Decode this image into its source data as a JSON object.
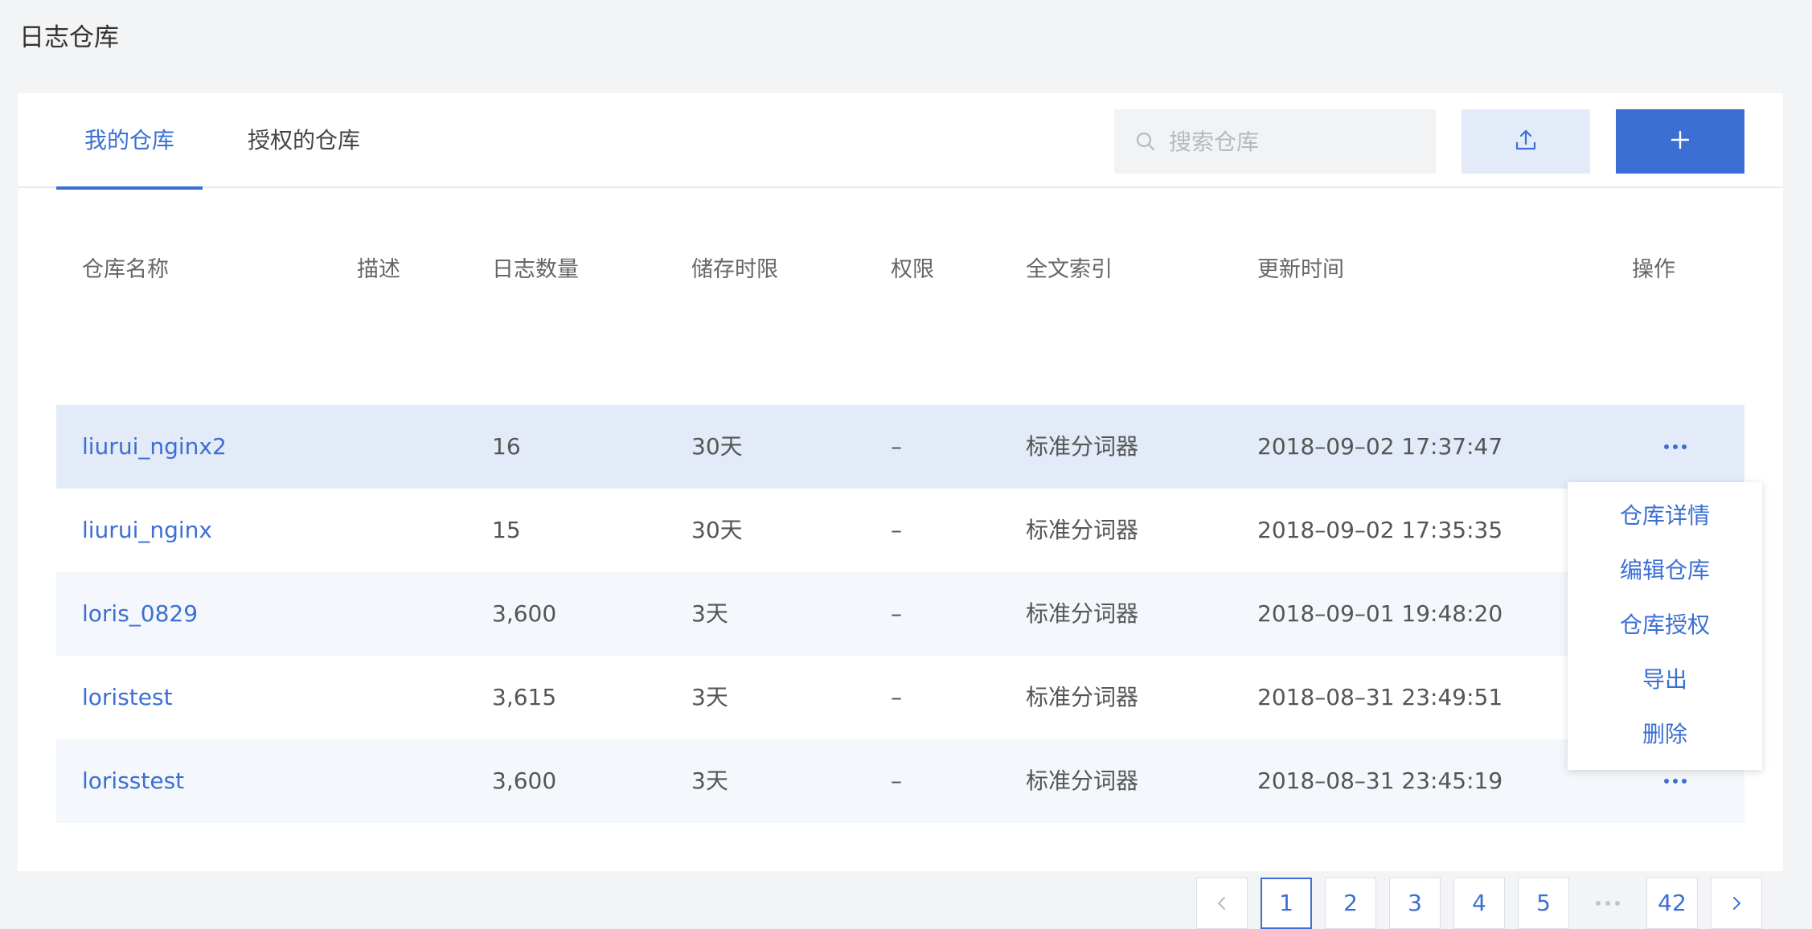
{
  "page": {
    "title": "日志仓库"
  },
  "tabs": [
    {
      "label": "我的仓库",
      "active": true
    },
    {
      "label": "授权的仓库",
      "active": false
    }
  ],
  "toolbar": {
    "search_placeholder": "搜索仓库",
    "upload_icon": "upload-icon",
    "add_icon": "plus-icon"
  },
  "table": {
    "headers": {
      "name": "仓库名称",
      "desc": "描述",
      "count": "日志数量",
      "retention": "储存时限",
      "perm": "权限",
      "index": "全文索引",
      "time": "更新时间",
      "ops": "操作"
    },
    "rows": [
      {
        "name": "liurui_nginx2",
        "desc": "",
        "count": "16",
        "retention": "30天",
        "perm": "–",
        "index": "标准分词器",
        "time": "2018–09–02 17:37:47"
      },
      {
        "name": "liurui_nginx",
        "desc": "",
        "count": "15",
        "retention": "30天",
        "perm": "–",
        "index": "标准分词器",
        "time": "2018–09–02 17:35:35"
      },
      {
        "name": "loris_0829",
        "desc": "",
        "count": "3,600",
        "retention": "3天",
        "perm": "–",
        "index": "标准分词器",
        "time": "2018–09–01 19:48:20"
      },
      {
        "name": "loristest",
        "desc": "",
        "count": "3,615",
        "retention": "3天",
        "perm": "–",
        "index": "标准分词器",
        "time": "2018–08–31 23:49:51"
      },
      {
        "name": "lorisstest",
        "desc": "",
        "count": "3,600",
        "retention": "3天",
        "perm": "–",
        "index": "标准分词器",
        "time": "2018–08–31 23:45:19"
      }
    ]
  },
  "dropdown": {
    "items": [
      "仓库详情",
      "编辑仓库",
      "仓库授权",
      "导出",
      "删除"
    ]
  },
  "pagination": {
    "prev": "<",
    "pages": [
      "1",
      "2",
      "3",
      "4",
      "5"
    ],
    "current": "1",
    "last": "42",
    "next": ">"
  },
  "colors": {
    "accent": "#3b6fd4",
    "selected_row": "#e3ebf8",
    "alt_row": "#f4f7fb",
    "background": "#f3f4f6"
  }
}
